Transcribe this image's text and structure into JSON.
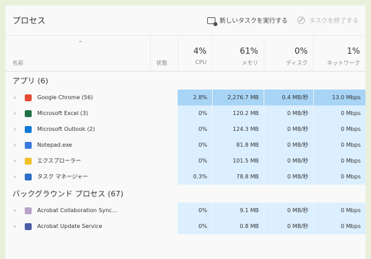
{
  "toolbar": {
    "title": "プロセス",
    "new_task": "新しいタスクを実行する",
    "end_task": "タスクを終了する"
  },
  "headers": {
    "name": "名前",
    "status": "状態",
    "cpu": {
      "pct": "4%",
      "label": "CPU"
    },
    "memory": {
      "pct": "61%",
      "label": "メモリ"
    },
    "disk": {
      "pct": "0%",
      "label": "ディスク"
    },
    "network": {
      "pct": "1%",
      "label": "ネットワーク"
    }
  },
  "apps_group": "アプリ (6)",
  "apps": [
    {
      "name": "Google Chrome (56)",
      "cpu": "2.8%",
      "mem": "2,276.7 MB",
      "disk": "0.4 MB/秒",
      "net": "13.0 Mbps",
      "icon": "chrome-icon",
      "color": "#e44b35"
    },
    {
      "name": "Microsoft Excel (3)",
      "cpu": "0%",
      "mem": "120.2 MB",
      "disk": "0 MB/秒",
      "net": "0 Mbps",
      "icon": "excel-icon",
      "color": "#1e7145"
    },
    {
      "name": "Microsoft Outlook (2)",
      "cpu": "0%",
      "mem": "124.3 MB",
      "disk": "0 MB/秒",
      "net": "0 Mbps",
      "icon": "outlook-icon",
      "color": "#0f78d4"
    },
    {
      "name": "Notepad.exe",
      "cpu": "0%",
      "mem": "81.8 MB",
      "disk": "0 MB/秒",
      "net": "0 Mbps",
      "icon": "notepad-icon",
      "color": "#3a79e0"
    },
    {
      "name": "エクスプローラー",
      "cpu": "0%",
      "mem": "101.5 MB",
      "disk": "0 MB/秒",
      "net": "0 Mbps",
      "icon": "folder-icon",
      "color": "#f0c02a"
    },
    {
      "name": "タスク マネージャー",
      "cpu": "0.3%",
      "mem": "78.8 MB",
      "disk": "0 MB/秒",
      "net": "0 Mbps",
      "icon": "taskmanager-icon",
      "color": "#2d6ec8"
    }
  ],
  "bg_group": "バックグラウンド プロセス (67)",
  "bg": [
    {
      "name": "Acrobat Collaboration Sync...",
      "cpu": "0%",
      "mem": "9.1 MB",
      "disk": "0 MB/秒",
      "net": "0 Mbps",
      "icon": "acrobat-icon",
      "color": "#b9a3c8"
    },
    {
      "name": "Acrobat Update Service",
      "cpu": "0%",
      "mem": "0.8 MB",
      "disk": "0 MB/秒",
      "net": "0 Mbps",
      "icon": "acrobat-update-icon",
      "color": "#4a5ba8"
    }
  ]
}
